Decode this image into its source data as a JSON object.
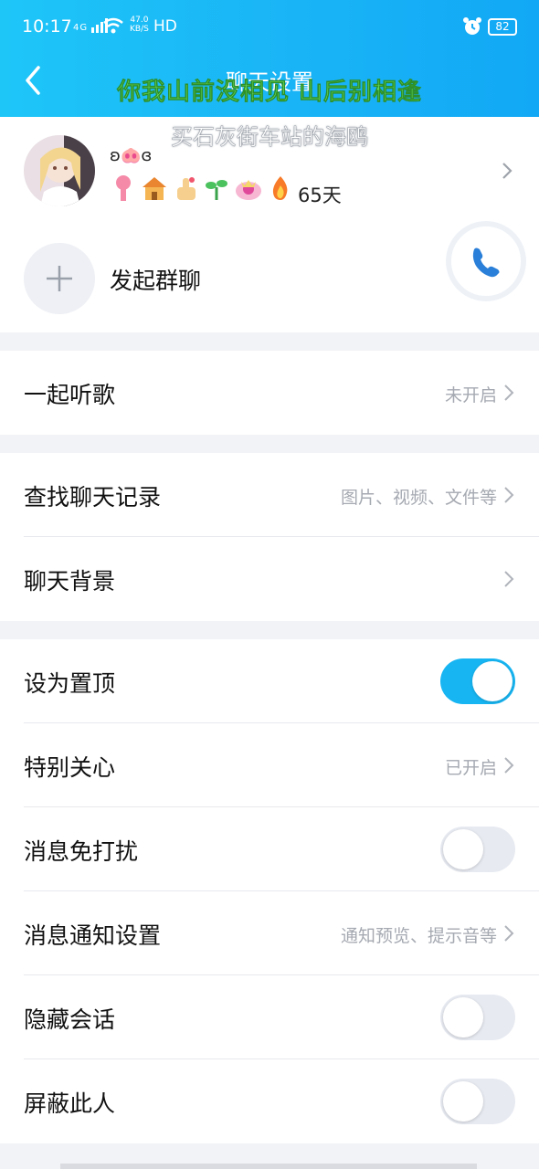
{
  "status_bar": {
    "time": "10:17",
    "signal": "4G",
    "speed_value": "47.0",
    "speed_unit": "KB/S",
    "hd": "HD",
    "battery": "82"
  },
  "header": {
    "title": "聊天设置",
    "lyric_line1": "你我山前没相见 山后别相逢",
    "lyric_line2": "买石灰街车站的海鸥"
  },
  "profile": {
    "name": "ʚ🐽ɞ",
    "badges": [
      "pin-badge-icon",
      "house-badge-icon",
      "thumbs-up-badge-icon",
      "sprout-badge-icon",
      "crown-badge-icon",
      "flame-badge-icon"
    ],
    "days": "65天"
  },
  "group_chat": {
    "label": "发起群聊"
  },
  "sections": {
    "listen": {
      "label": "一起听歌",
      "value": "未开启"
    },
    "search": {
      "label": "查找聊天记录",
      "value": "图片、视频、文件等"
    },
    "background": {
      "label": "聊天背景"
    },
    "pin": {
      "label": "设为置顶",
      "on": true
    },
    "special": {
      "label": "特别关心",
      "value": "已开启"
    },
    "dnd": {
      "label": "消息免打扰",
      "on": false
    },
    "notify": {
      "label": "消息通知设置",
      "value": "通知预览、提示音等"
    },
    "hide": {
      "label": "隐藏会话",
      "on": false
    },
    "block": {
      "label": "屏蔽此人",
      "on": false
    }
  },
  "colors": {
    "header_gradient_start": "#1ec6f8",
    "header_gradient_end": "#12a8f5",
    "toggle_on": "#17b5f2",
    "lyric_green": "#7ef56a"
  }
}
